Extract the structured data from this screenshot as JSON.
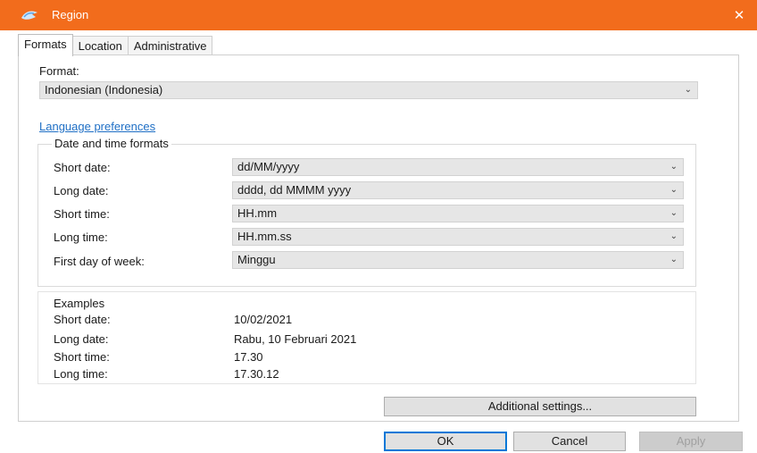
{
  "window": {
    "title": "Region",
    "close_glyph": "✕"
  },
  "tabs": [
    {
      "label": "Formats"
    },
    {
      "label": "Location"
    },
    {
      "label": "Administrative"
    }
  ],
  "format": {
    "label": "Format:",
    "value": "Indonesian (Indonesia)"
  },
  "language_link": "Language preferences",
  "date_time_formats": {
    "title": "Date and time formats",
    "rows": [
      {
        "label": "Short date:",
        "value": "dd/MM/yyyy"
      },
      {
        "label": "Long date:",
        "value": "dddd, dd MMMM yyyy"
      },
      {
        "label": "Short time:",
        "value": "HH.mm"
      },
      {
        "label": "Long time:",
        "value": "HH.mm.ss"
      },
      {
        "label": "First day of week:",
        "value": "Minggu"
      }
    ]
  },
  "examples": {
    "title": "Examples",
    "rows": [
      {
        "label": "Short date:",
        "value": "10/02/2021"
      },
      {
        "label": "Long date:",
        "value": "Rabu, 10 Februari 2021"
      },
      {
        "label": "Short time:",
        "value": "17.30"
      },
      {
        "label": "Long time:",
        "value": "17.30.12"
      }
    ]
  },
  "buttons": {
    "additional_settings": "Additional settings...",
    "ok": "OK",
    "cancel": "Cancel",
    "apply": "Apply"
  },
  "colors": {
    "titlebar": "#f26c1c",
    "link": "#1f6fc5"
  },
  "icons": {
    "app": "region-globe-icon",
    "close": "close-icon",
    "dropdown": "chevron-down-icon"
  }
}
